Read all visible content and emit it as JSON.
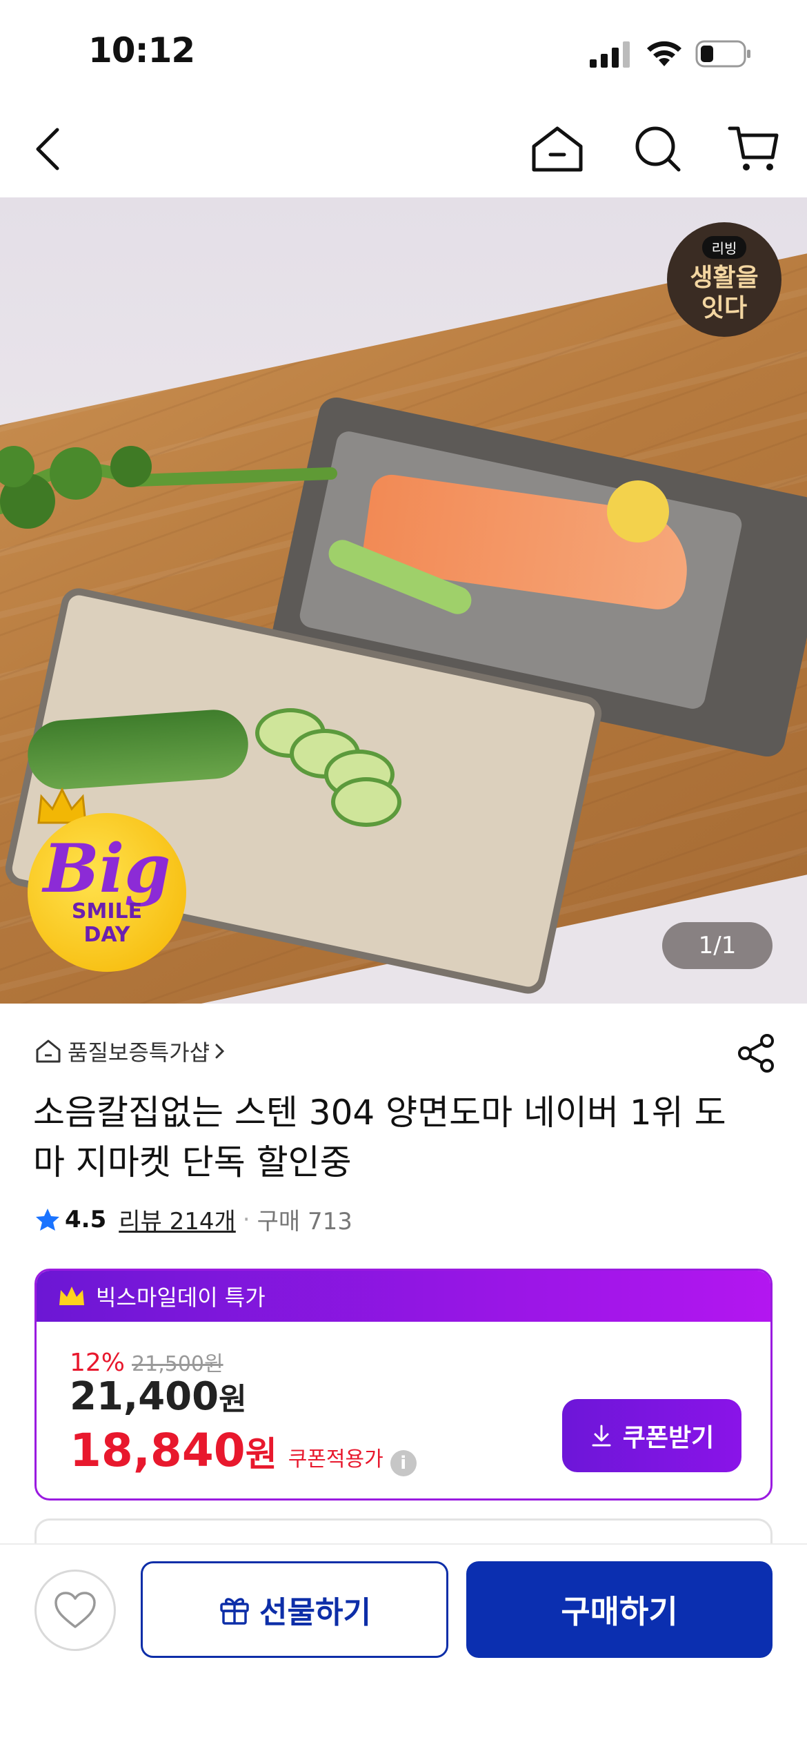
{
  "status_bar": {
    "time": "10:12"
  },
  "header": {
    "back_icon": "chevron-left-icon",
    "home_icon": "home-icon",
    "search_icon": "search-icon",
    "cart_icon": "cart-icon"
  },
  "hero": {
    "brand_badge": {
      "top": "리빙",
      "line1": "생활을",
      "line2": "잇다"
    },
    "promo_badge": {
      "big": "Big",
      "line1": "SMILE",
      "line2": "DAY"
    },
    "counter": "1/1"
  },
  "product": {
    "store": "품질보증특가샵",
    "title": "소음칼집없는 스텐 304 양면도마 네이버 1위 도마 지마켓 단독 할인중",
    "rating": "4.5",
    "reviews": "리뷰 214개",
    "sold": "구매 713"
  },
  "deal": {
    "header": "빅스마일데이 특가",
    "discount": "12%",
    "original_price": "21,500원",
    "price": "21,400",
    "price_unit": "원",
    "final_price": "18,840",
    "final_unit": "원",
    "final_label": "쿠폰적용가",
    "coupon_button": "쿠폰받기"
  },
  "bottom": {
    "gift_button": "선물하기",
    "buy_button": "구매하기"
  },
  "colors": {
    "primary_blue": "#0b2fb0",
    "deal_purple": "#8a14e8",
    "sale_red": "#e8182d",
    "rating_star": "#1a73ff"
  }
}
